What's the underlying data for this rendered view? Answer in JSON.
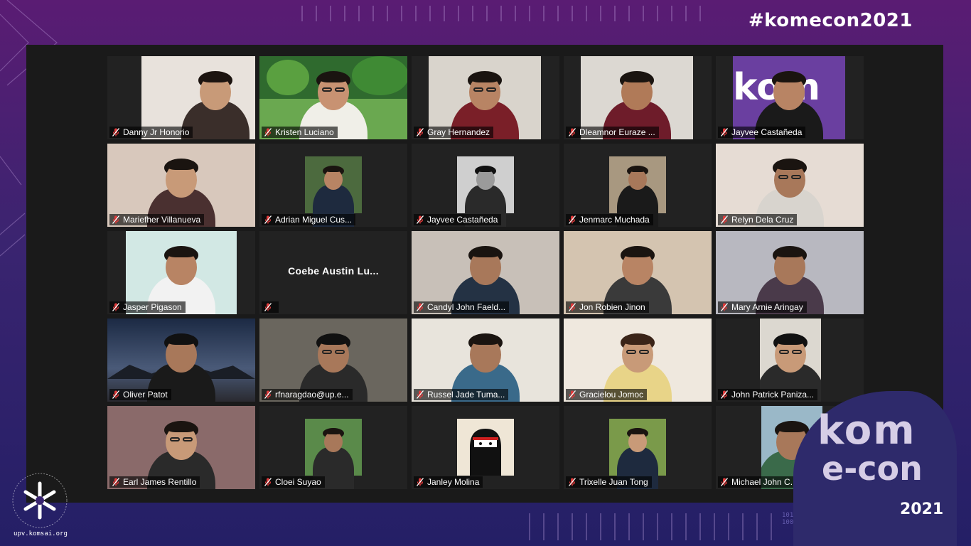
{
  "hashtag": "#komecon2021",
  "logo_url": "upv.komsai.org",
  "event_logo": {
    "line1": "kom",
    "line2": "e-con",
    "year": "2021"
  },
  "colors": {
    "active_speaker": "#e8e97a",
    "muted_mic": "#e03a3a",
    "panel": "#1a1a1a"
  },
  "participants": [
    {
      "name": "Danny Jr Honorio"
    },
    {
      "name": "Kristen Luciano"
    },
    {
      "name": "Gray Hernandez"
    },
    {
      "name": "Dleamnor Euraze ..."
    },
    {
      "name": "Jayvee Castañeda"
    },
    {
      "name": "Mariefher Villanueva"
    },
    {
      "name": "Adrian Miguel Cus..."
    },
    {
      "name": "Jayvee Castañeda"
    },
    {
      "name": "Jenmarc Muchada"
    },
    {
      "name": "Relyn Dela Cruz"
    },
    {
      "name": "Jasper Pigason"
    },
    {
      "name": "",
      "big_name": "Coebe Austin Lu..."
    },
    {
      "name": "Candyl John Faeld..."
    },
    {
      "name": "Jon Robien Jinon"
    },
    {
      "name": "Mary Arnie Aringay"
    },
    {
      "name": "Oliver Patot"
    },
    {
      "name": "rfnaragdao@up.e..."
    },
    {
      "name": "Russel Jade Tuma..."
    },
    {
      "name": "Gracielou Jomoc"
    },
    {
      "name": "John Patrick Paniza..."
    },
    {
      "name": "Earl James Rentillo"
    },
    {
      "name": "Cloei Suyao"
    },
    {
      "name": "Janley Molina"
    },
    {
      "name": "Trixelle Juan Tong"
    },
    {
      "name": "Michael John C..."
    }
  ]
}
